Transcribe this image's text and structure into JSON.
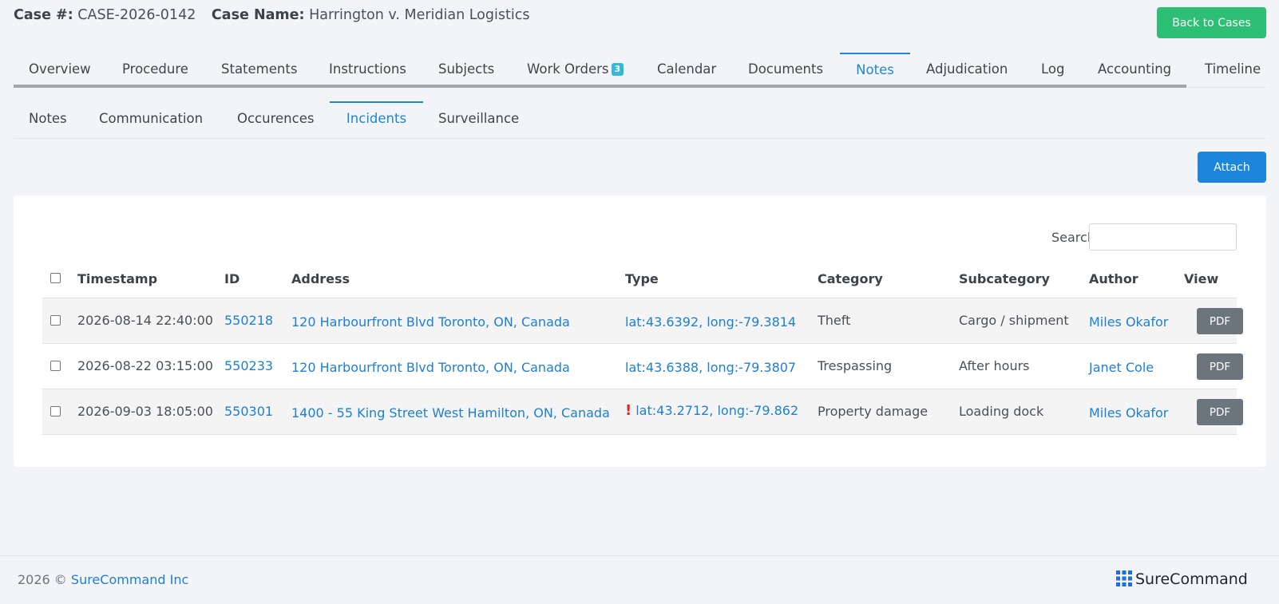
{
  "header": {
    "case_number_label": "Case #:",
    "case_number": "CASE-2026-0142",
    "case_name_label": "Case Name:",
    "case_name": "Harrington v. Meridian Logistics",
    "back_button": "Back to Cases"
  },
  "tabs": [
    {
      "label": "Overview"
    },
    {
      "label": "Procedure"
    },
    {
      "label": "Statements"
    },
    {
      "label": "Instructions"
    },
    {
      "label": "Subjects"
    },
    {
      "label": "Work Orders",
      "badge": "3"
    },
    {
      "label": "Calendar"
    },
    {
      "label": "Documents"
    },
    {
      "label": "Notes",
      "active": true
    },
    {
      "label": "Adjudication"
    },
    {
      "label": "Log"
    },
    {
      "label": "Accounting"
    },
    {
      "label": "Timeline"
    }
  ],
  "subtabs": [
    {
      "label": "Notes"
    },
    {
      "label": "Communication"
    },
    {
      "label": "Occurences"
    },
    {
      "label": "Incidents",
      "active": true
    },
    {
      "label": "Surveillance"
    }
  ],
  "attach_button": "Attach",
  "search": {
    "label": "Search:",
    "value": ""
  },
  "table": {
    "columns": [
      "Timestamp",
      "ID",
      "Address",
      "Type",
      "Category",
      "Subcategory",
      "Author",
      "View"
    ],
    "rows": [
      {
        "timestamp": "2026-08-14 22:40:00",
        "id": "550218",
        "address": "120 Harbourfront Blvd Toronto, ON, Canada",
        "type": "lat:43.6392, long:-79.3814",
        "category": "Theft",
        "subcategory": "Cargo / shipment",
        "author": "Miles Okafor",
        "view": "PDF",
        "alert": false
      },
      {
        "timestamp": "2026-08-22 03:15:00",
        "id": "550233",
        "address": "120 Harbourfront Blvd Toronto, ON, Canada",
        "type": "lat:43.6388, long:-79.3807",
        "category": "Trespassing",
        "subcategory": "After hours",
        "author": "Janet Cole",
        "view": "PDF",
        "alert": false
      },
      {
        "timestamp": "2026-09-03 18:05:00",
        "id": "550301",
        "address": "1400 - 55 King Street West Hamilton, ON, Canada",
        "type": "lat:43.2712, long:-79.862",
        "category": "Property damage",
        "subcategory": "Loading dock",
        "author": "Miles Okafor",
        "view": "PDF",
        "alert": true,
        "alert_symbol": "!"
      }
    ]
  },
  "footer": {
    "year": "2026 ©",
    "company": "SureCommand Inc",
    "brand": "SureCommand"
  },
  "colors": {
    "accent": "#1d86d6",
    "success": "#2dbf73",
    "secondary": "#6c757d",
    "alert": "#e02424"
  }
}
